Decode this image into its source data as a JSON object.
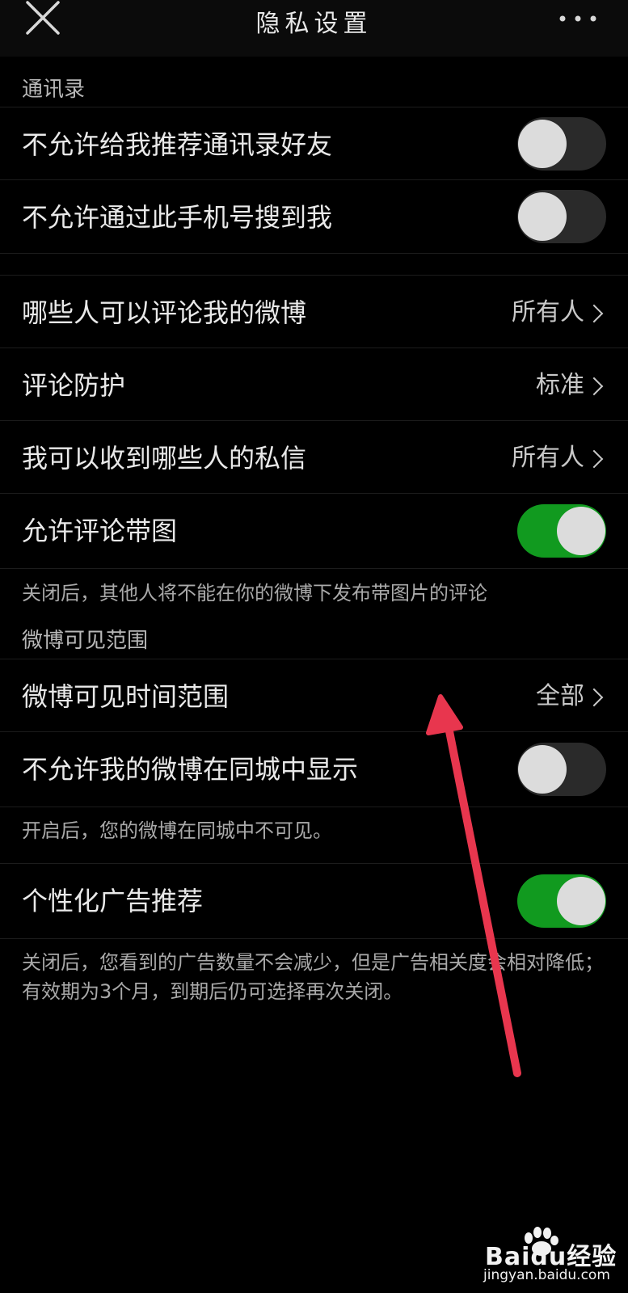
{
  "header": {
    "title": "隐私设置",
    "close_icon": "close-icon",
    "more_icon": "more-icon"
  },
  "contacts_section": {
    "label": "通讯录",
    "rows": [
      {
        "label": "不允许给我推荐通讯录好友",
        "toggle": "off"
      },
      {
        "label": "不允许通过此手机号搜到我",
        "toggle": "off"
      }
    ]
  },
  "privacy_rows": [
    {
      "label": "哪些人可以评论我的微博",
      "value": "所有人"
    },
    {
      "label": "评论防护",
      "value": "标准"
    },
    {
      "label": "我可以收到哪些人的私信",
      "value": "所有人"
    }
  ],
  "comment_images": {
    "label": "允许评论带图",
    "toggle": "on",
    "hint": "关闭后，其他人将不能在你的微博下发布带图片的评论"
  },
  "visibility_section": {
    "label": "微博可见范围",
    "time_range": {
      "label": "微博可见时间范围",
      "value": "全部"
    },
    "same_city": {
      "label": "不允许我的微博在同城中显示",
      "toggle": "off",
      "hint": "开启后，您的微博在同城中不可见。"
    }
  },
  "ads": {
    "label": "个性化广告推荐",
    "toggle": "on",
    "hint": "关闭后，您看到的广告数量不会减少，但是广告相关度会相对降低；有效期为3个月，到期后仍可选择再次关闭。"
  },
  "watermark": {
    "brand": "Baidu经验",
    "url": "jingyan.baidu.com"
  },
  "colors": {
    "background": "#000000",
    "toggle_on": "#119a1f",
    "toggle_off": "#2a2a2a",
    "annotation_arrow": "#e8364e"
  }
}
